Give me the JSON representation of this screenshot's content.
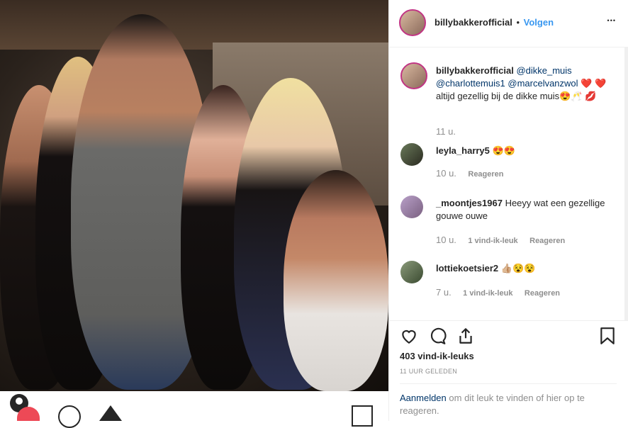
{
  "post": {
    "username": "billybakkerofficial",
    "dot": "•",
    "follow_label": "Volgen",
    "more_label": "•••"
  },
  "caption": {
    "username": "billybakkerofficial",
    "mention1": "@dikke_muis",
    "mention2": "@charlottemuis1",
    "mention3": "@marcelvanzwol",
    "heart": "❤️",
    "text": "altijd gezellig bij de dikke muis😍🥂",
    "lips": "💋",
    "age": "11 u."
  },
  "comments": [
    {
      "username": "leyla_harry5",
      "text": "😍😍",
      "age": "10 u.",
      "likes": "",
      "reply": "Reageren"
    },
    {
      "username": "_moontjes1967",
      "text": "Heeyy wat een gezellige gouwe ouwe",
      "age": "10 u.",
      "likes": "1 vind-ik-leuk",
      "reply": "Reageren"
    },
    {
      "username": "lottiekoetsier2",
      "text": "👍🏼😵😵",
      "age": "7 u.",
      "likes": "1 vind-ik-leuk",
      "reply": "Reageren"
    }
  ],
  "stats": {
    "likes_label": "403 vind-ik-leuks",
    "timestamp": "11 UUR GELEDEN"
  },
  "login_prompt": {
    "link": "Aanmelden",
    "text": "om dit leuk te vinden of hier op te reageren."
  },
  "icons": {
    "like": "heart-icon",
    "comment": "comment-icon",
    "share": "share-icon",
    "save": "bookmark-icon",
    "more": "more-icon"
  }
}
